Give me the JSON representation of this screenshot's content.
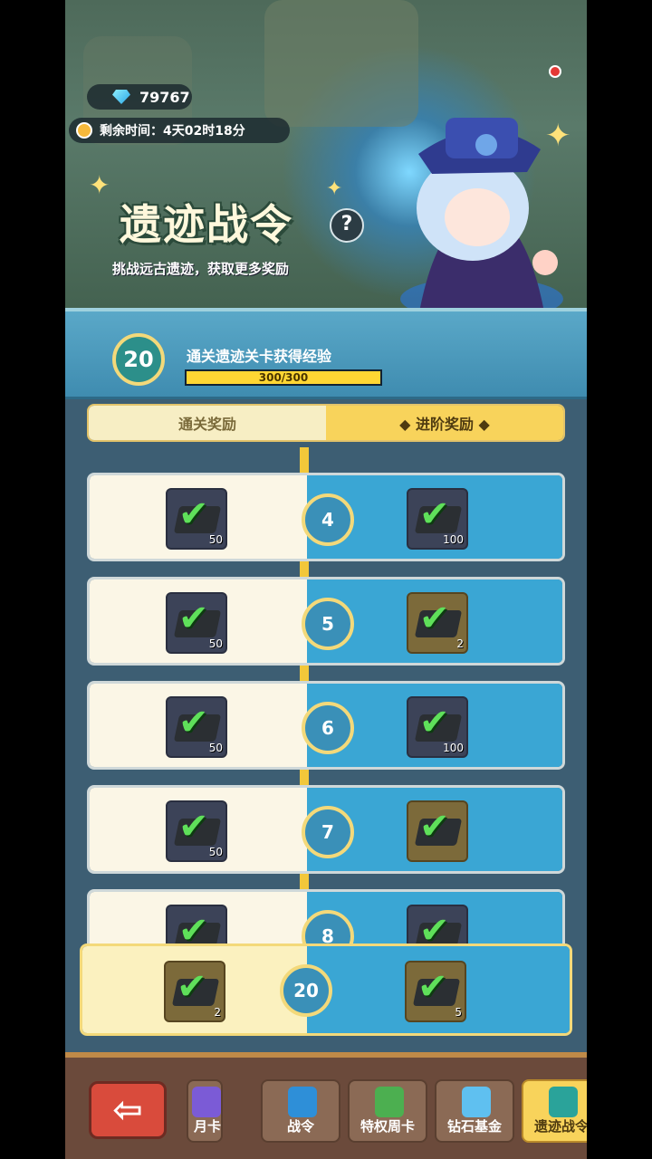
{
  "header": {
    "diamonds": "79767",
    "time_left_label": "剩余时间：4天02时18分",
    "title": "遗迹战令",
    "subtitle": "挑战远古遗迹，获取更多奖励",
    "help_label": "?"
  },
  "level": {
    "current": "20",
    "description": "通关遗迹关卡获得经验",
    "xp_text": "300/300",
    "xp_fraction": 1.0
  },
  "tabs": {
    "free_label": "通关奖励",
    "advanced_label": "◆ 进阶奖励 ◆"
  },
  "rewards": [
    {
      "level": "4",
      "free_count": "50",
      "free_style": "dark",
      "adv_count": "100",
      "adv_style": "dark"
    },
    {
      "level": "5",
      "free_count": "50",
      "free_style": "dark",
      "adv_count": "2",
      "adv_style": "brown"
    },
    {
      "level": "6",
      "free_count": "50",
      "free_style": "dark",
      "adv_count": "100",
      "adv_style": "dark"
    },
    {
      "level": "7",
      "free_count": "50",
      "free_style": "dark",
      "adv_count": "",
      "adv_style": "brown"
    },
    {
      "level": "8",
      "free_count": "",
      "free_style": "dark",
      "adv_count": "",
      "adv_style": "dark"
    }
  ],
  "final_reward": {
    "level": "20",
    "free_count": "2",
    "adv_count": "5"
  },
  "nav": {
    "back_label": "⇦",
    "items": [
      {
        "label": "月卡",
        "color": "#7b5bd6"
      },
      {
        "label": "战令",
        "color": "#2e8fd8"
      },
      {
        "label": "特权周卡",
        "color": "#4caf50"
      },
      {
        "label": "钻石基金",
        "color": "#5fc0f0"
      },
      {
        "label": "遗迹战令",
        "color": "#2aa39a"
      }
    ]
  },
  "colors": {
    "accent_gold": "#f8d35b",
    "panel_blue": "#3aa6d4"
  }
}
